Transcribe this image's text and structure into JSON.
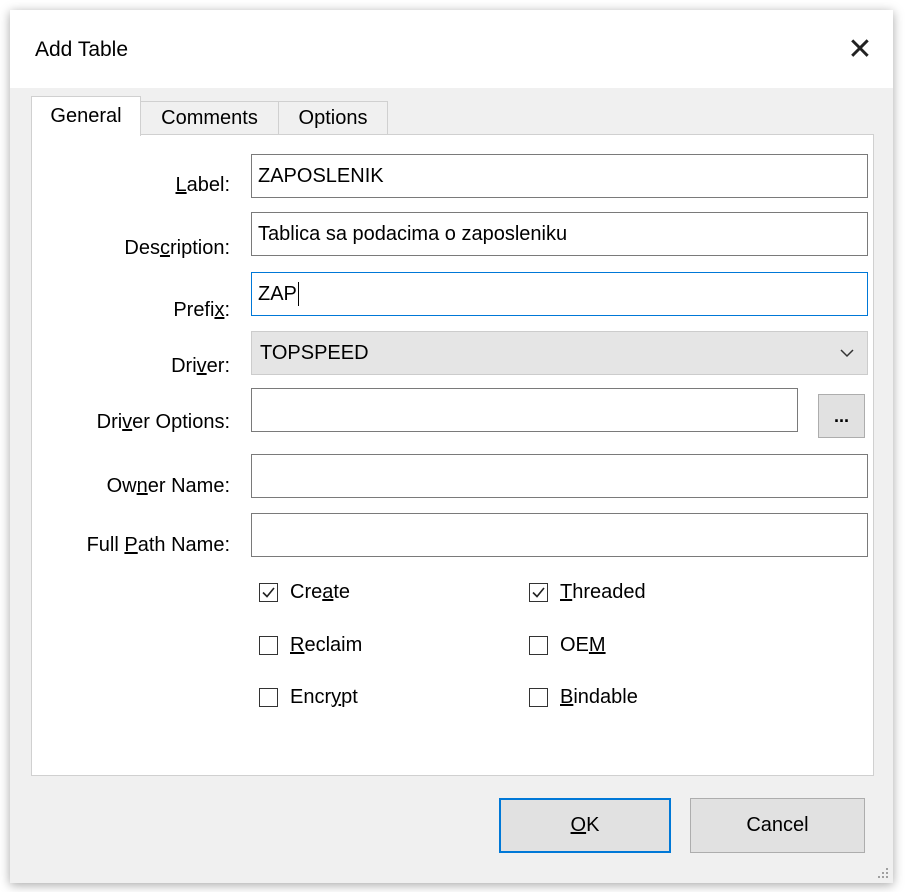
{
  "window": {
    "title": "Add Table",
    "close_glyph": "✕"
  },
  "tabs": [
    {
      "label": "General",
      "active": true
    },
    {
      "label": "Comments",
      "active": false
    },
    {
      "label": "Options",
      "active": false
    }
  ],
  "fields": {
    "label": {
      "label_pre": "",
      "label_u": "L",
      "label_post": "abel:",
      "value": "ZAPOSLENIK"
    },
    "description": {
      "label_pre": "Des",
      "label_u": "c",
      "label_post": "ription:",
      "value": "Tablica sa podacima o zaposleniku"
    },
    "prefix": {
      "label_pre": "Prefi",
      "label_u": "x",
      "label_post": ":",
      "value": "ZAP"
    },
    "driver": {
      "label_pre": "Dri",
      "label_u": "v",
      "label_post": "er:",
      "value": "TOPSPEED"
    },
    "driver_options": {
      "label_pre": "Dri",
      "label_u": "v",
      "label_post": "er Options:",
      "value": "",
      "button_label": "..."
    },
    "owner_name": {
      "label_pre": "Ow",
      "label_u": "n",
      "label_post": "er Name:",
      "value": ""
    },
    "full_path_name": {
      "label_pre": "Full ",
      "label_u": "P",
      "label_post": "ath Name:",
      "value": ""
    }
  },
  "checkboxes": {
    "create": {
      "pre": "Cre",
      "u": "a",
      "post": "te",
      "checked": true
    },
    "reclaim": {
      "pre": "",
      "u": "R",
      "post": "eclaim",
      "checked": false
    },
    "encrypt": {
      "pre": "Encr",
      "u": "y",
      "post": "pt",
      "checked": false
    },
    "threaded": {
      "pre": "",
      "u": "T",
      "post": "hreaded",
      "checked": true
    },
    "oem": {
      "pre": "OE",
      "u": "M",
      "post": "",
      "checked": false
    },
    "bindable": {
      "pre": "",
      "u": "B",
      "post": "indable",
      "checked": false
    }
  },
  "buttons": {
    "ok": {
      "pre": "",
      "u": "O",
      "post": "K"
    },
    "cancel": {
      "label": "Cancel"
    }
  },
  "colors": {
    "focus": "#0078d7",
    "dialog_bg": "#f0f0f0",
    "select_bg": "#e5e5e5"
  },
  "icons": {
    "close": "close-icon",
    "dropdown": "chevron-down-icon",
    "resize": "resize-grip-icon"
  }
}
